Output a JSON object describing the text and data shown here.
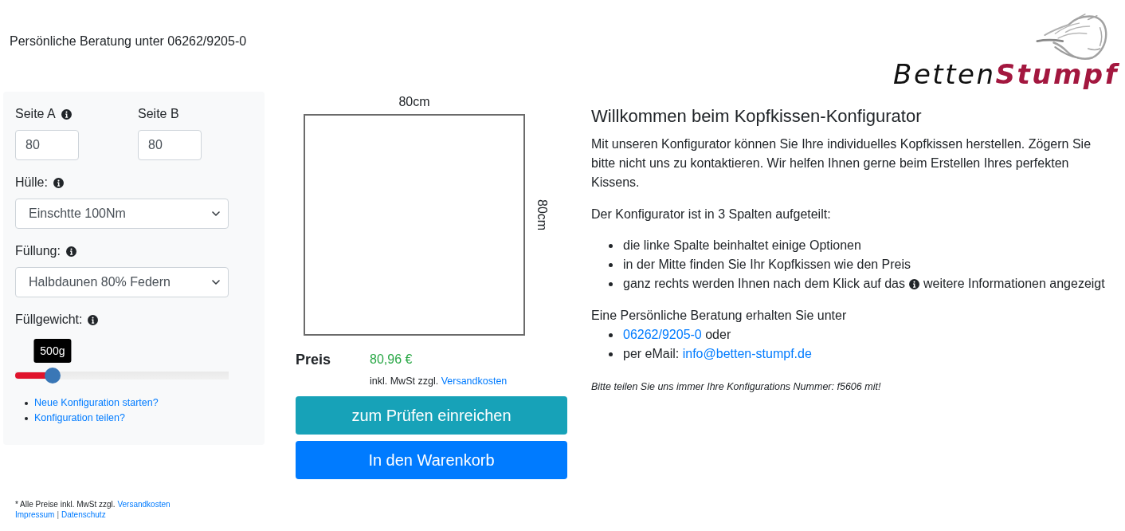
{
  "header": {
    "consultation": "Persönliche Beratung unter 06262/9205-0"
  },
  "logo": {
    "wordmark": "Betten**Stumpf**"
  },
  "options": {
    "side_a": {
      "label": "Seite A",
      "info": true,
      "value": "80"
    },
    "side_b": {
      "label": "Seite B",
      "info": false,
      "value": "80"
    },
    "cover": {
      "label": "Hülle:",
      "info": true,
      "value": "Einschtte 100Nm"
    },
    "filling": {
      "label": "Füllung:",
      "info": true,
      "value": "Halbdaunen 80% Federn"
    },
    "fill_weight": {
      "label": "Füllgewicht:",
      "info": true,
      "reading": "500g",
      "level": 0.175
    },
    "links": [
      "Neue Konfiguration starten?",
      "Konfiguration teilen?"
    ]
  },
  "preview": {
    "width_label": "80cm",
    "height_label": "80cm"
  },
  "price": {
    "label": "Preis",
    "value": "80,96 €",
    "note": "inkl. MwSt zzgl.",
    "note_link": "Versandkosten"
  },
  "buttons": [
    {
      "label": "zum Prüfen einreichen",
      "kind": "info"
    },
    {
      "label": "In den Warenkorb",
      "kind": "primary"
    }
  ],
  "info": {
    "title": "Willkommen beim Kopfkissen-Konfigurator",
    "intro": "Mit unseren Konfigurator können Sie Ihre individuelles Kopfkissen herstellen. Zögern Sie bitte nicht uns zu kontaktieren. Wir helfen Ihnen gerne beim Erstellen Ihres perfekten Kissens.",
    "columns_heading": "Der Konfigurator ist in 3 Spalten aufgeteilt:",
    "column_items": [
      {
        "kind": "text",
        "text": "die linke Spalte beinhaltet einige Optionen"
      },
      {
        "kind": "text",
        "text": "in der Mitte finden Sie Ihr Kopfkissen wie den Preis"
      },
      {
        "kind": "info_icon",
        "text": "ganz rechts werden Ihnen nach dem Klick auf das",
        "text_after": "weitere Informationen angezeigt"
      }
    ],
    "contact_heading": "Eine Persönliche Beratung erhalten Sie unter",
    "contact_items": [
      {
        "link": "06262/9205-0",
        "after": "oder"
      },
      {
        "before": "per eMail:",
        "link": "info@betten-stumpf.de"
      }
    ],
    "note": "Bitte teilen Sie uns immer Ihre Konfigurations Nummer: f5606 mit!"
  },
  "footer": {
    "note": "* Alle Preise inkl. MwSt zzgl.",
    "note_link": "Versandkosten",
    "links": [
      "Impressum",
      "Datenschutz"
    ],
    "separator": "|"
  }
}
